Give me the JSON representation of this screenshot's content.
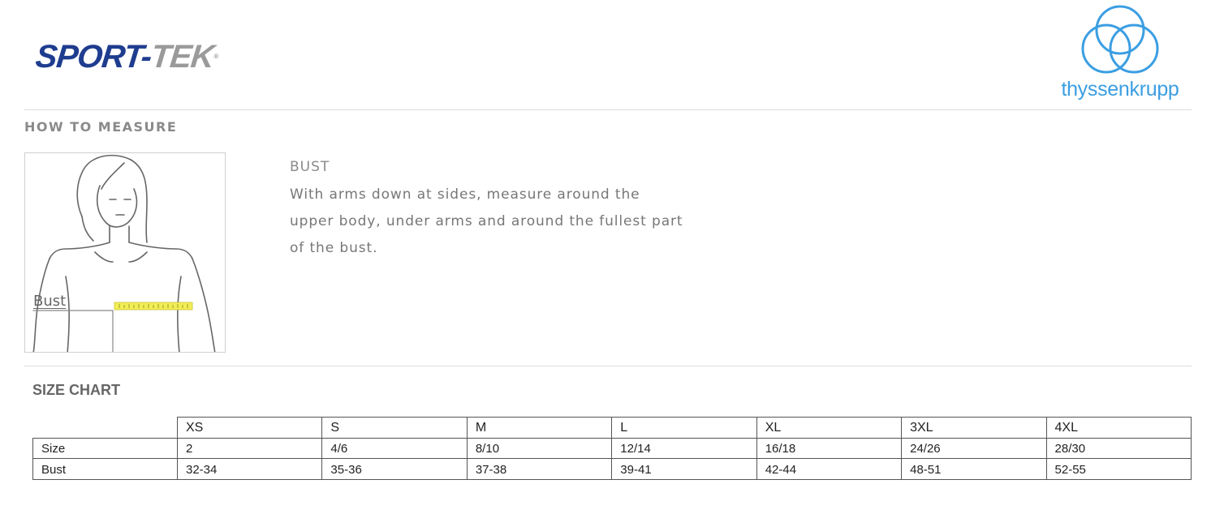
{
  "header": {
    "brand_logo": {
      "part1": "SPORT-",
      "part2": "TEK",
      "mark": "®"
    },
    "partner_logo": {
      "name": "thyssenkrupp",
      "icon": "three-rings-logo-icon"
    }
  },
  "colors": {
    "brand_blue": "#1f3d8f",
    "brand_gray": "#9a9a9a",
    "partner_blue": "#3b9ee2",
    "tape_yellow": "#f2ee55"
  },
  "measure": {
    "heading": "HOW TO MEASURE",
    "figure_label": "Bust",
    "title": "BUST",
    "lines": [
      "With arms down at sides, measure around the",
      "upper body, under arms and around the fullest part",
      "of the bust."
    ]
  },
  "size_chart": {
    "heading": "SIZE CHART",
    "columns": [
      "XS",
      "S",
      "M",
      "L",
      "XL",
      "3XL",
      "4XL"
    ],
    "rows": [
      {
        "label": "Size",
        "values": [
          "2",
          "4/6",
          "8/10",
          "12/14",
          "16/18",
          "24/26",
          "28/30"
        ]
      },
      {
        "label": "Bust",
        "values": [
          "32-34",
          "35-36",
          "37-38",
          "39-41",
          "42-44",
          "48-51",
          "52-55"
        ]
      }
    ]
  }
}
